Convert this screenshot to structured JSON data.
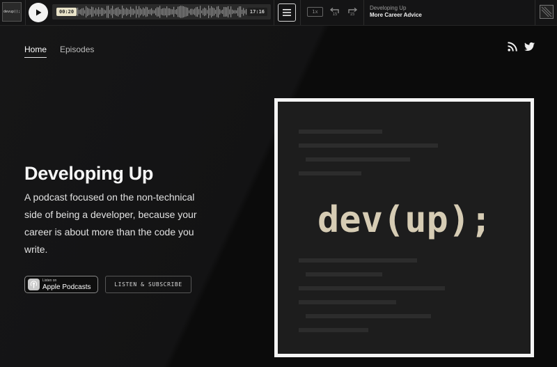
{
  "player": {
    "thumb_label": "devup();",
    "current_time": "00:20",
    "duration": "17:16",
    "speed": "1x",
    "skip_back": "15",
    "skip_forward": "15",
    "show_name": "Developing Up",
    "episode_title": "More Career Advice",
    "progress": 0.02
  },
  "nav": {
    "items": [
      {
        "label": "Home",
        "active": true
      },
      {
        "label": "Episodes",
        "active": false
      }
    ]
  },
  "social": {
    "icons": [
      "rss-icon",
      "twitter-icon"
    ]
  },
  "hero": {
    "title": "Developing Up",
    "description": "A podcast focused on the non-technical side of being a developer, because your career is about more than the code you write.",
    "apple_badge_small": "Listen on",
    "apple_badge_big": "Apple Podcasts",
    "subscribe_label": "LISTEN & SUBSCRIBE"
  },
  "artwork": {
    "text": "dev(up);"
  },
  "colors": {
    "background": "#0f0f10",
    "accent_text": "#d6ccb4",
    "art_border": "#f4f4f4"
  }
}
